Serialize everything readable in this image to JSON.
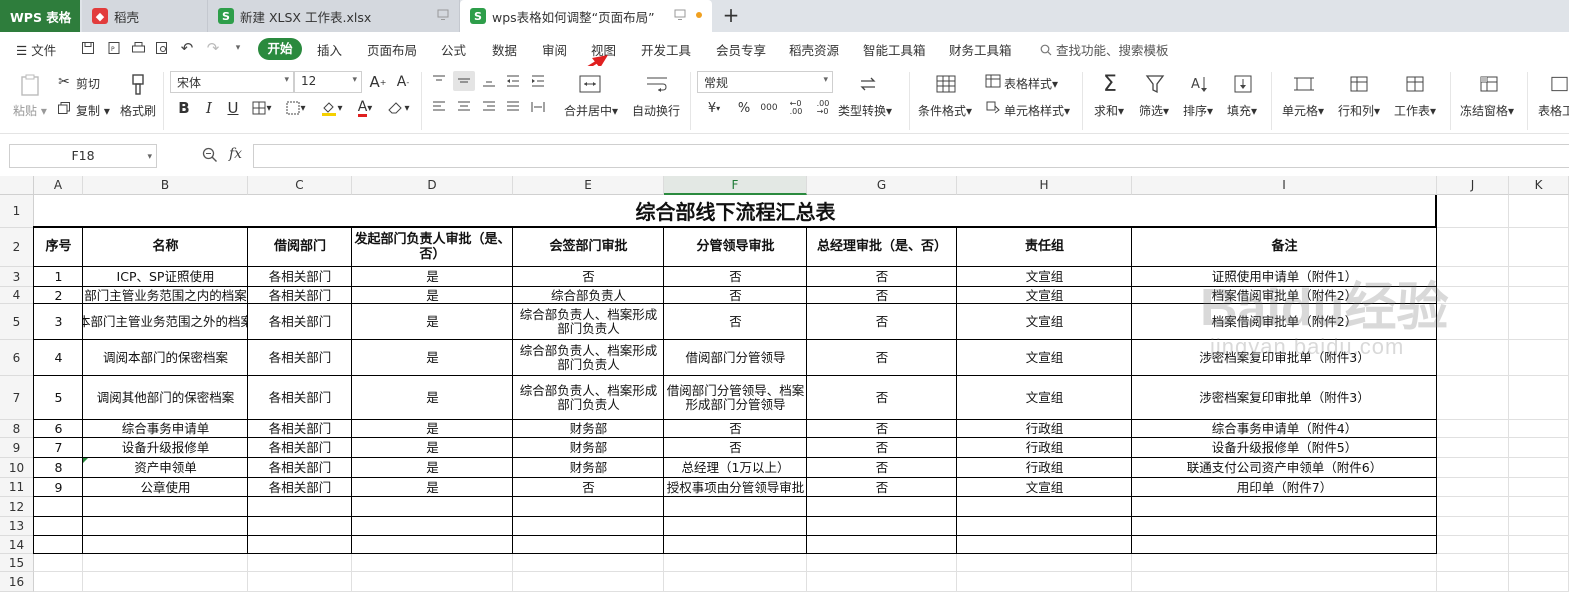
{
  "tabs": [
    {
      "label": "WPS 表格"
    },
    {
      "label": "稻壳"
    },
    {
      "label": "新建 XLSX 工作表.xlsx"
    },
    {
      "label": "wps表格如何调整“页面布局”"
    }
  ],
  "menu": {
    "file": "文件",
    "start": "开始",
    "items": [
      "插入",
      "页面布局",
      "公式",
      "数据",
      "审阅",
      "视图",
      "开发工具",
      "会员专享",
      "稻壳资源",
      "智能工具箱",
      "财务工具箱"
    ],
    "search": "查找功能、搜索模板"
  },
  "ribbon": {
    "paste": "粘贴",
    "cut": "剪切",
    "copy": "复制",
    "format_painter": "格式刷",
    "font_name": "宋体",
    "font_size": "12",
    "merge": "合并居中",
    "wrap": "自动换行",
    "number_format": "常规",
    "type_convert": "类型转换",
    "cond_format": "条件格式",
    "table_style": "表格样式",
    "cell_style": "单元格样式",
    "sum": "求和",
    "filter": "筛选",
    "sort": "排序",
    "fill": "填充",
    "cell": "单元格",
    "row_col": "行和列",
    "worksheet": "工作表",
    "freeze": "冻结窗格",
    "table_tools": "表格工"
  },
  "formula_bar": {
    "name_box": "F18",
    "fx": "fx",
    "value": ""
  },
  "columns": [
    "A",
    "B",
    "C",
    "D",
    "E",
    "F",
    "G",
    "H",
    "I",
    "J",
    "K"
  ],
  "selected_column": "F",
  "rows": [
    "1",
    "2",
    "3",
    "4",
    "5",
    "6",
    "7",
    "8",
    "9",
    "10",
    "11",
    "12",
    "13",
    "14",
    "15",
    "16"
  ],
  "sheet": {
    "title": "综合部线下流程汇总表",
    "headers": [
      "序号",
      "名称",
      "借阅部门",
      "发起部门负责人审批（是、否）",
      "会签部门审批",
      "分管领导审批",
      "总经理审批（是、否）",
      "责任组",
      "备注"
    ],
    "records": [
      [
        "1",
        "ICP、SP证照使用",
        "各相关部门",
        "是",
        "否",
        "否",
        "否",
        "文宣组",
        "证照使用申请单（附件1）"
      ],
      [
        "2",
        "部门主管业务范围之内的档案",
        "各相关部门",
        "是",
        "综合部负责人",
        "否",
        "否",
        "文宣组",
        "档案借阅审批单（附件2）"
      ],
      [
        "3",
        "本部门主管业务范围之外的档案",
        "各相关部门",
        "是",
        "综合部负责人、档案形成部门负责人",
        "否",
        "否",
        "文宣组",
        "档案借阅审批单（附件2）"
      ],
      [
        "4",
        "调阅本部门的保密档案",
        "各相关部门",
        "是",
        "综合部负责人、档案形成部门负责人",
        "借阅部门分管领导",
        "否",
        "文宣组",
        "涉密档案复印审批单（附件3）"
      ],
      [
        "5",
        "调阅其他部门的保密档案",
        "各相关部门",
        "是",
        "综合部负责人、档案形成部门负责人",
        "借阅部门分管领导、档案形成部门分管领导",
        "否",
        "文宣组",
        "涉密档案复印审批单（附件3）"
      ],
      [
        "6",
        "综合事务申请单",
        "各相关部门",
        "是",
        "财务部",
        "否",
        "否",
        "行政组",
        "综合事务申请单（附件4）"
      ],
      [
        "7",
        "设备升级报修单",
        "各相关部门",
        "是",
        "财务部",
        "否",
        "否",
        "行政组",
        "设备升级报修单（附件5）"
      ],
      [
        "8",
        "资产申领单",
        "各相关部门",
        "是",
        "财务部",
        "总经理（1万以上）",
        "否",
        "行政组",
        "联通支付公司资产申领单（附件6）"
      ],
      [
        "9",
        "公章使用",
        "各相关部门",
        "是",
        "否",
        "授权事项由分管领导审批",
        "否",
        "文宣组",
        "用印单（附件7）"
      ]
    ]
  },
  "watermark": {
    "main": "Baidu经验",
    "sub": "jingyan.baidu.com"
  }
}
